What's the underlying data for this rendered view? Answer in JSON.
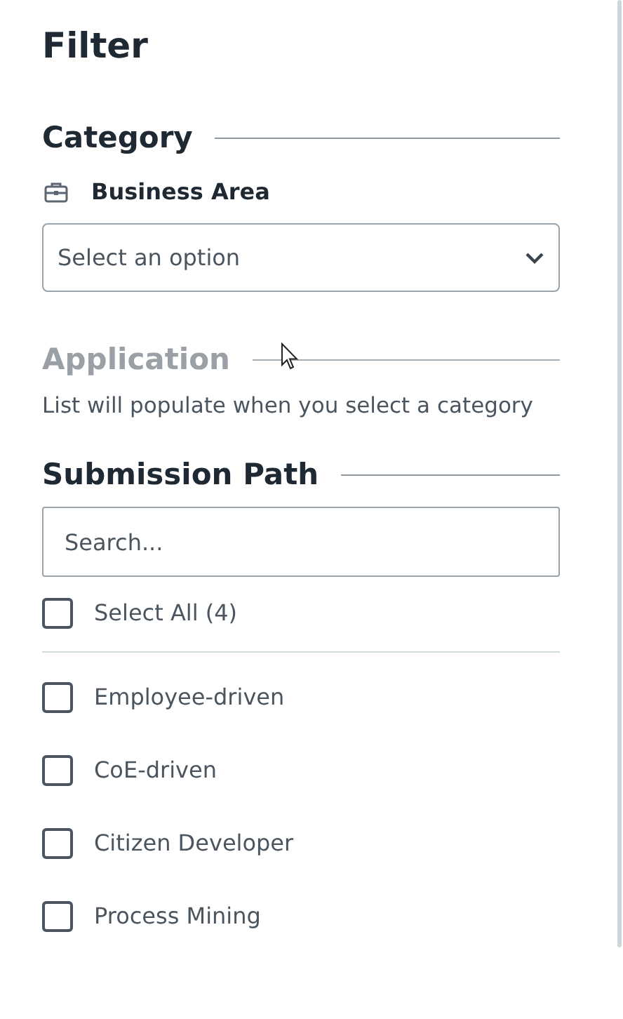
{
  "title": "Filter",
  "sections": [
    {
      "kind": "select",
      "heading": "Category",
      "disabled": false,
      "field_label": "Business Area",
      "placeholder": "Select an option"
    },
    {
      "kind": "note",
      "heading": "Application",
      "disabled": true,
      "note": "List will populate when you select a category"
    },
    {
      "kind": "checklist",
      "heading": "Submission Path",
      "disabled": false,
      "placeholder": "Search...",
      "select_all": {
        "label": "Select All (4)",
        "checked": false
      },
      "options": [
        {
          "label": "Employee-driven",
          "checked": false
        },
        {
          "label": "CoE-driven",
          "checked": false
        },
        {
          "label": "Citizen Developer",
          "checked": false
        },
        {
          "label": "Process Mining",
          "checked": false
        }
      ]
    }
  ]
}
